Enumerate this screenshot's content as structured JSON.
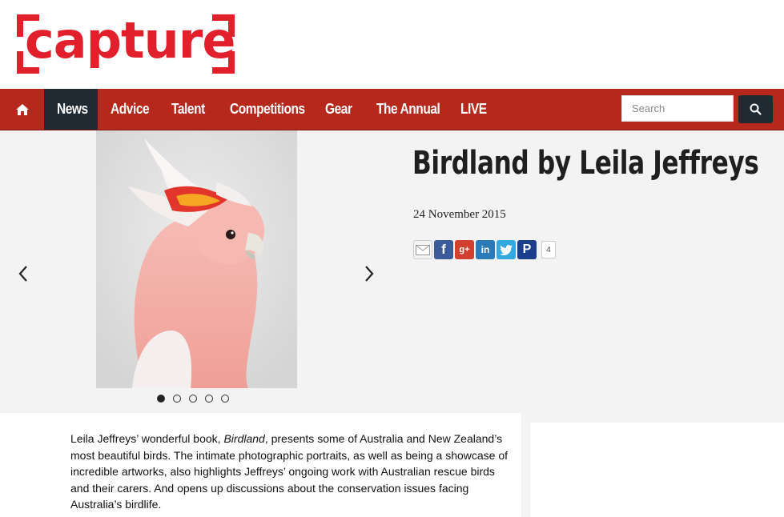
{
  "logo": {
    "text": "capture",
    "color": "#e2202b"
  },
  "nav": {
    "home_icon": "home-icon",
    "items": [
      {
        "label": "News",
        "active": true
      },
      {
        "label": "Advice",
        "active": false
      },
      {
        "label": "Talent",
        "active": false
      },
      {
        "label": "Competitions",
        "active": false
      },
      {
        "label": "Gear",
        "active": false
      },
      {
        "label": "The Annual",
        "active": false
      },
      {
        "label": "LIVE",
        "active": false
      }
    ],
    "search_placeholder": "Search",
    "search_icon": "search-icon",
    "bar_color": "#b6281c",
    "active_color": "#1f2a33"
  },
  "slider": {
    "prev_icon": "chevron-left-icon",
    "next_icon": "chevron-right-icon",
    "slide_count": 5,
    "active_slide": 1
  },
  "article": {
    "title": "Birdland by Leila Jeffreys",
    "date": "24 November 2015",
    "share": {
      "icons": [
        "email-icon",
        "facebook-icon",
        "google-plus-icon",
        "linkedin-icon",
        "twitter-icon",
        "pinterest-icon"
      ],
      "count": "4"
    },
    "body_before_em": "Leila Jeffreys’ wonderful book, ",
    "body_em": "Birdland",
    "body_after_em": ", presents some of Australia and New Zealand’s most beautiful birds. The intimate photographic portraits, as well as being a showcase of incredible artworks, also highlights Jeffreys’ ongoing work with Australian rescue birds and their carers. And opens up discussions about the conservation issues facing Australia’s birdlife."
  }
}
